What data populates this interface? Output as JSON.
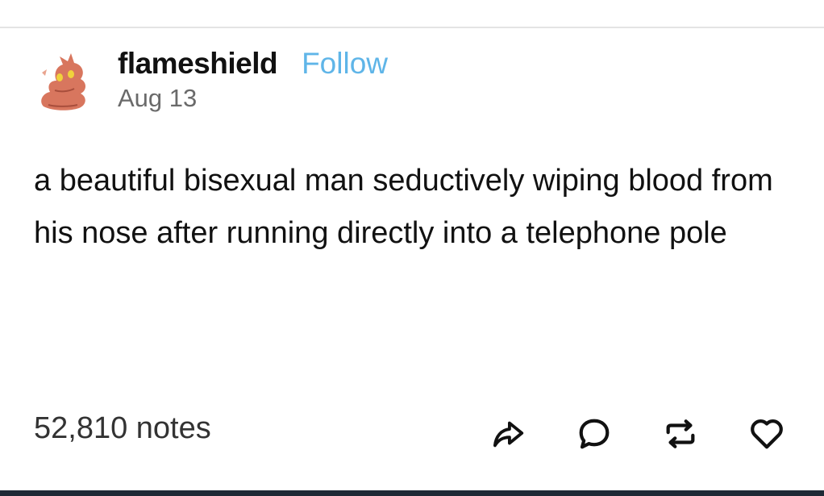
{
  "post": {
    "author": "flameshield",
    "follow_label": "Follow",
    "date": "Aug 13",
    "body": "a beautiful bisexual man seductively wiping blood from his nose after running directly into a telephone pole"
  },
  "footer": {
    "notes": "52,810 notes",
    "actions": [
      "share-icon",
      "reply-icon",
      "reblog-icon",
      "like-icon"
    ]
  },
  "colors": {
    "follow_link": "#5fb5e8",
    "bottom_bar": "#1e2a36"
  }
}
